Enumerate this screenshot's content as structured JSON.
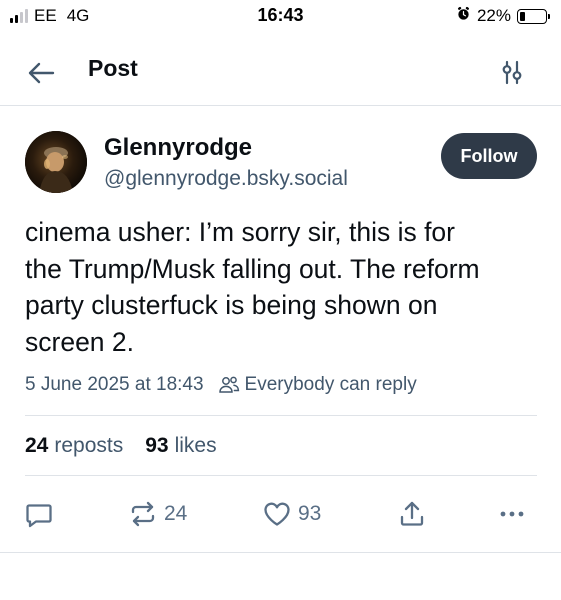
{
  "status_bar": {
    "carrier": "EE",
    "network": "4G",
    "time": "16:43",
    "battery_percent": "22%",
    "battery_level": 0.22,
    "signal_bars_active": 2,
    "signal_bars_total": 4
  },
  "header": {
    "title": "Post",
    "back_icon": "arrow-left-icon",
    "filter_icon": "sliders-icon"
  },
  "post": {
    "author": {
      "display_name": "Glennyrodge",
      "handle": "@glennyrodge.bsky.social"
    },
    "follow_label": "Follow",
    "text": "cinema usher: I’m sorry sir, this is for\nthe Trump/Musk falling out. The reform\nparty clusterfuck is being shown on\nscreen 2.",
    "timestamp": "5 June 2025 at 18:43",
    "reply_setting": "Everybody can reply",
    "stats": {
      "reposts_count": "24",
      "reposts_label": "reposts",
      "likes_count": "93",
      "likes_label": "likes"
    },
    "actions": {
      "reply_icon": "comment-icon",
      "repost_icon": "repost-icon",
      "repost_count": "24",
      "like_icon": "heart-icon",
      "like_count": "93",
      "share_icon": "share-icon",
      "more_icon": "more-icon"
    }
  },
  "colors": {
    "text_primary": "#0b0f14",
    "text_secondary": "#42576c",
    "action_icon": "#5a6f86",
    "follow_button_bg": "#2f3a48",
    "divider": "#dfe3e8"
  }
}
